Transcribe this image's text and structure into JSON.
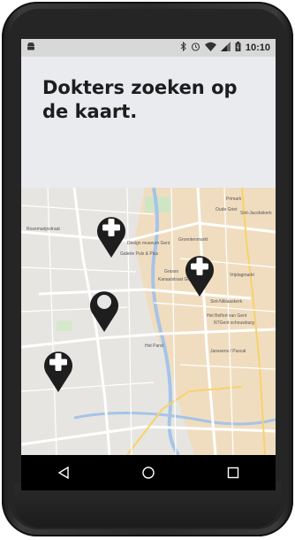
{
  "status_bar": {
    "time": "10:10",
    "left_icon": "android-icon",
    "icons": [
      "bluetooth-icon",
      "alarm-icon",
      "wifi-icon",
      "signal-icon",
      "battery-icon"
    ]
  },
  "header": {
    "title": "Dokters zoeken op de kaart."
  },
  "map": {
    "labels": [
      "Primark",
      "Oude Griet",
      "Sint-Jacobskerk",
      "Groentenmarkt",
      "Design museum Gent",
      "Galerie Puls & Plus",
      "Grasso",
      "Kanaalstraat Gent",
      "Sint-Niklaaskerk",
      "Het Belfort van Gent",
      "NTGent schouwburg",
      "Het Pand",
      "Janssens / Pascal",
      "Vrijdagmarkt",
      "Rozemarijnstraat"
    ],
    "markers": [
      {
        "type": "doctor",
        "icon": "medical-cross-icon"
      },
      {
        "type": "doctor",
        "icon": "medical-cross-icon"
      },
      {
        "type": "current-location",
        "icon": "location-pin-icon"
      },
      {
        "type": "doctor",
        "icon": "medical-cross-icon"
      }
    ]
  },
  "nav_bar": {
    "buttons": [
      "back-icon",
      "home-icon",
      "recents-icon"
    ]
  },
  "colors": {
    "header_bg": "#e9ebef",
    "map_bg": "#e7e5e1",
    "city_center": "#f0ddc0",
    "water": "#a5c4e8",
    "marker": "#1e1e1e"
  }
}
